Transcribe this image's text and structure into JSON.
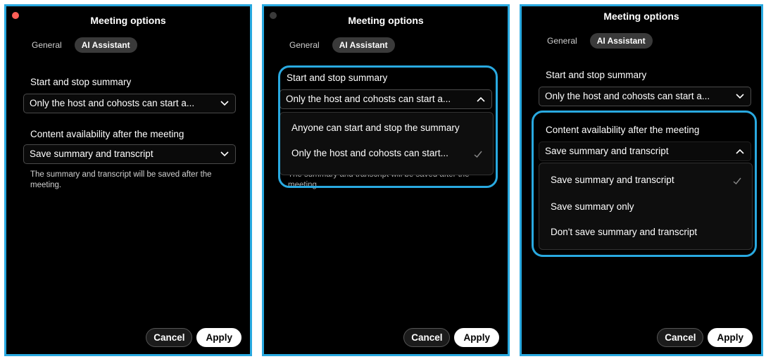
{
  "window": {
    "title": "Meeting options",
    "close_color": "#ff5f57",
    "inactive_dot_color": "#3a3a3a"
  },
  "tabs": [
    "General",
    "AI Assistant"
  ],
  "active_tab": "AI Assistant",
  "summary_control": {
    "label": "Start and stop summary",
    "selected": "Only the host and cohosts can start a...",
    "options": [
      "Anyone can start and stop the summary",
      "Only the host and cohosts can start..."
    ],
    "checked_index": 1
  },
  "content_control": {
    "label": "Content availability after the meeting",
    "selected": "Save summary and transcript",
    "options": [
      "Save summary and transcript",
      "Save summary only",
      "Don't save summary and transcript"
    ],
    "checked_index": 0
  },
  "help_text": "The summary and transcript will be saved after the meeting.",
  "help_text_partial": "The summary and transcript will be saved after the meeting.",
  "buttons": {
    "cancel": "Cancel",
    "apply": "Apply"
  },
  "colors": {
    "highlight": "#29a9e0",
    "background": "#000000"
  }
}
